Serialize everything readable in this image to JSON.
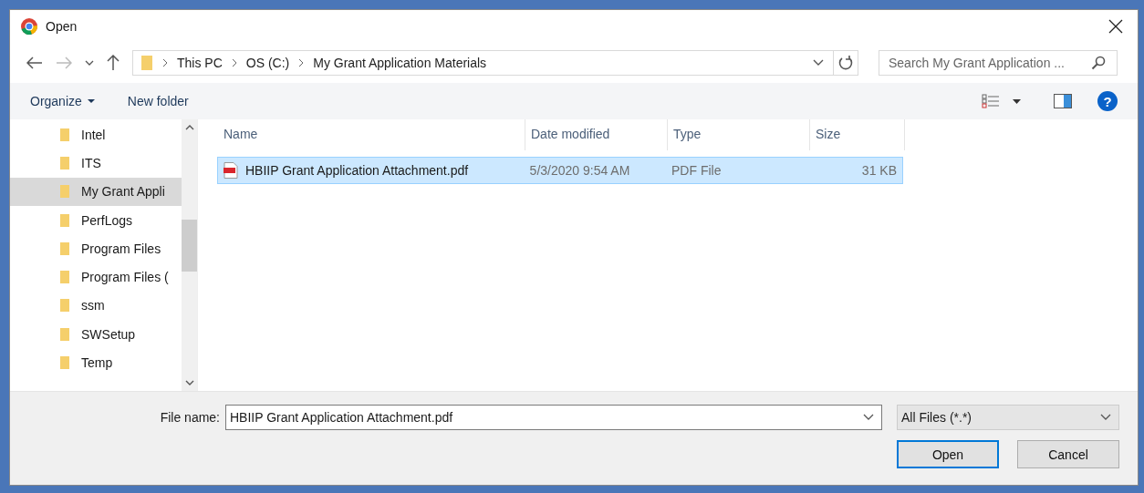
{
  "window": {
    "title": "Open"
  },
  "address": {
    "crumbs": [
      "This PC",
      "OS (C:)",
      "My Grant Application Materials"
    ]
  },
  "search": {
    "placeholder": "Search My Grant Application ..."
  },
  "toolbar": {
    "organize": "Organize",
    "new_folder": "New folder",
    "help": "?"
  },
  "sidebar": {
    "items": [
      {
        "label": "Intel",
        "selected": false
      },
      {
        "label": "ITS",
        "selected": false
      },
      {
        "label": "My Grant Appli",
        "selected": true
      },
      {
        "label": "PerfLogs",
        "selected": false
      },
      {
        "label": "Program Files",
        "selected": false
      },
      {
        "label": "Program Files (",
        "selected": false
      },
      {
        "label": "ssm",
        "selected": false
      },
      {
        "label": "SWSetup",
        "selected": false
      },
      {
        "label": "Temp",
        "selected": false
      }
    ]
  },
  "table": {
    "columns": [
      "Name",
      "Date modified",
      "Type",
      "Size"
    ],
    "rows": [
      {
        "name": "HBIIP Grant Application Attachment.pdf",
        "date": "5/3/2020 9:54 AM",
        "type": "PDF File",
        "size": "31 KB",
        "selected": true
      }
    ]
  },
  "footer": {
    "file_name_label": "File name:",
    "file_name": "HBIIP Grant Application Attachment.pdf",
    "filter": "All Files (*.*)",
    "open": "Open",
    "cancel": "Cancel"
  }
}
